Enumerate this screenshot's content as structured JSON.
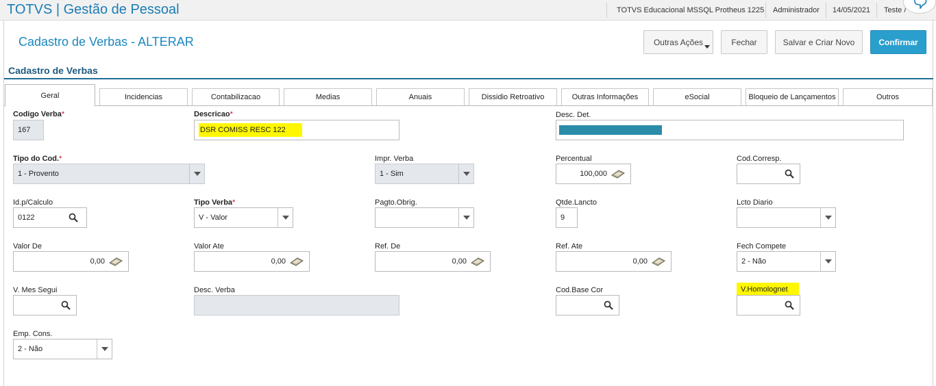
{
  "app": {
    "title": "TOTVS | Gestão de Pessoal",
    "environment": "TOTVS Educacional MSSQL Protheus 1225",
    "user": "Administrador",
    "date": "14/05/2021",
    "extra": "Teste /"
  },
  "header": {
    "title": "Cadastro de Verbas - ALTERAR",
    "buttons": {
      "other_actions": "Outras Ações",
      "close": "Fechar",
      "save_new": "Salvar e Criar Novo",
      "confirm": "Confirmar"
    }
  },
  "section": {
    "title": "Cadastro de Verbas"
  },
  "tabs": [
    "Geral",
    "Incidencias",
    "Contabilizacao",
    "Medias",
    "Anuais",
    "Dissidio Retroativo",
    "Outras Informações",
    "eSocial",
    "Bloqueio de Lançamentos",
    "Outros"
  ],
  "fields": {
    "codigo_verba": {
      "label": "Codigo Verba",
      "value": "167"
    },
    "descricao": {
      "label": "Descricao",
      "value": "DSR COMISS RESC 122"
    },
    "desc_det": {
      "label": "Desc. Det."
    },
    "tipo_cod": {
      "label": "Tipo do Cod.",
      "value": "1 - Provento"
    },
    "impr_verba": {
      "label": "Impr. Verba",
      "value": "1 - Sim"
    },
    "percentual": {
      "label": "Percentual",
      "value": "100,000"
    },
    "cod_corresp": {
      "label": "Cod.Corresp.",
      "value": ""
    },
    "id_calculo": {
      "label": "Id.p/Calculo",
      "value": "0122"
    },
    "tipo_verba": {
      "label": "Tipo Verba",
      "value": "V - Valor"
    },
    "pagto_obrig": {
      "label": "Pagto.Obrig.",
      "value": ""
    },
    "qtde_lancto": {
      "label": "Qtde.Lancto",
      "value": "9"
    },
    "lcto_diario": {
      "label": "Lcto Diario",
      "value": ""
    },
    "valor_de": {
      "label": "Valor De",
      "value": "0,00"
    },
    "valor_ate": {
      "label": "Valor Ate",
      "value": "0,00"
    },
    "ref_de": {
      "label": "Ref. De",
      "value": "0,00"
    },
    "ref_ate": {
      "label": "Ref. Ate",
      "value": "0,00"
    },
    "fech_compete": {
      "label": "Fech Compete",
      "value": "2 - Não"
    },
    "v_mes_segui": {
      "label": "V. Mes Segui",
      "value": ""
    },
    "desc_verba": {
      "label": "Desc. Verba",
      "value": ""
    },
    "cod_base_cor": {
      "label": "Cod.Base Cor",
      "value": ""
    },
    "v_homolognet": {
      "label": "V.Homolognet",
      "value": ""
    },
    "emp_cons": {
      "label": "Emp. Cons.",
      "value": "2 - Não"
    }
  },
  "required_marker": "*",
  "colors": {
    "brand": "#1b7db4",
    "confirm_button": "#2a9fce",
    "section_rule": "#1e6c95",
    "highlight": "#fff700"
  }
}
